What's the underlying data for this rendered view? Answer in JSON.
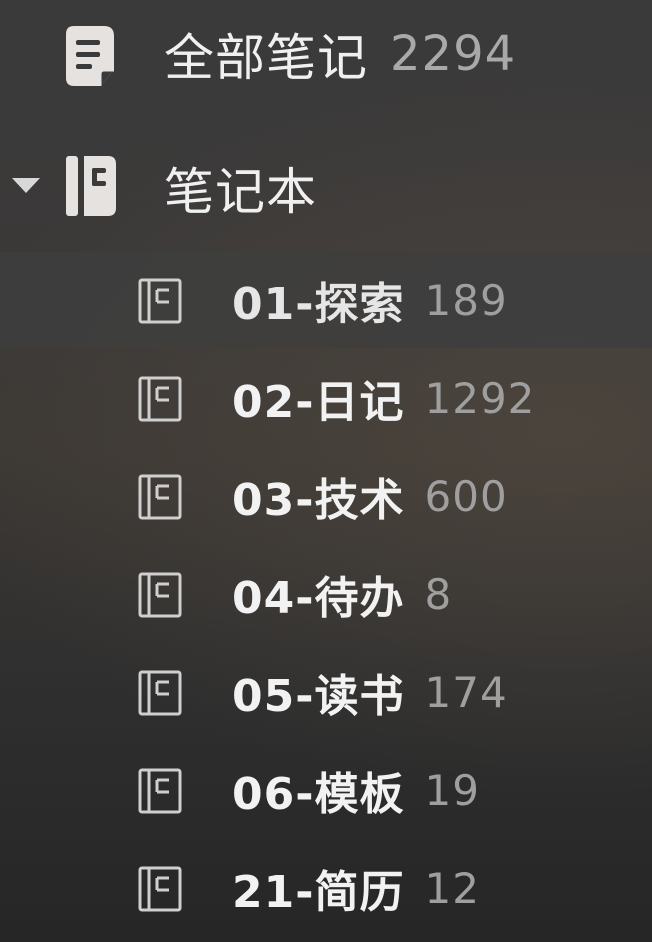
{
  "sidebar": {
    "all_notes": {
      "label": "全部笔记",
      "count": "2294",
      "icon": "all-notes-icon"
    },
    "notebooks": {
      "label": "笔记本",
      "icon": "notebook-stack-icon",
      "expanded": true,
      "items": [
        {
          "label": "01-探索",
          "count": "189",
          "selected": true
        },
        {
          "label": "02-日记",
          "count": "1292",
          "selected": false
        },
        {
          "label": "03-技术",
          "count": "600",
          "selected": false
        },
        {
          "label": "04-待办",
          "count": "8",
          "selected": false
        },
        {
          "label": "05-读书",
          "count": "174",
          "selected": false
        },
        {
          "label": "06-模板",
          "count": "19",
          "selected": false
        },
        {
          "label": "21-简历",
          "count": "12",
          "selected": false
        }
      ]
    }
  },
  "colors": {
    "text_primary": "#f2f2f2",
    "text_count": "#a9a9a9",
    "icon": "#e6e2e0",
    "selected_bg": "#3e3e3e"
  }
}
